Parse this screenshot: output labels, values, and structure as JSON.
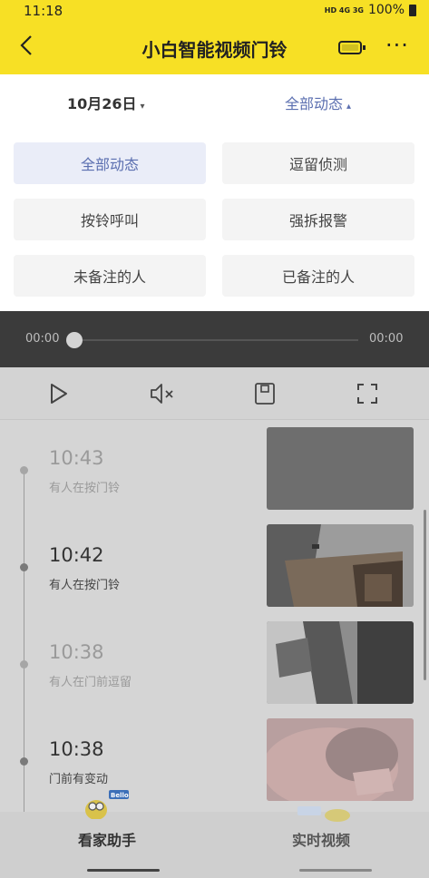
{
  "status_bar": {
    "time": "11:18",
    "indicators": "HD 4G 3G",
    "battery": "100%"
  },
  "header": {
    "title": "小白智能视频门铃",
    "back_icon": "chevron-left-icon",
    "battery_icon": "battery-icon",
    "more_icon": "more-dots-icon",
    "accent": "#f7e025"
  },
  "filter": {
    "date": "10月26日",
    "date_caret": "▾",
    "category": "全部动态",
    "category_caret": "▴"
  },
  "chips": [
    {
      "label": "全部动态",
      "active": true
    },
    {
      "label": "逗留侦测",
      "active": false
    },
    {
      "label": "按铃呼叫",
      "active": false
    },
    {
      "label": "强拆报警",
      "active": false
    },
    {
      "label": "未备注的人",
      "active": false
    },
    {
      "label": "已备注的人",
      "active": false
    }
  ],
  "player": {
    "current_time": "00:00",
    "total_time": "00:00",
    "progress": 0
  },
  "controls": [
    "play-icon",
    "mute-icon",
    "save-icon",
    "fullscreen-icon"
  ],
  "events": [
    {
      "time": "10:43",
      "desc": "有人在按门铃"
    },
    {
      "time": "10:42",
      "desc": "有人在按门铃"
    },
    {
      "time": "10:38",
      "desc": "有人在门前逗留"
    },
    {
      "time": "10:38",
      "desc": "门前有变动"
    }
  ],
  "bottom_nav": {
    "tab1": "看家助手",
    "tab2": "实时视频",
    "mascot_label": "Bello"
  }
}
